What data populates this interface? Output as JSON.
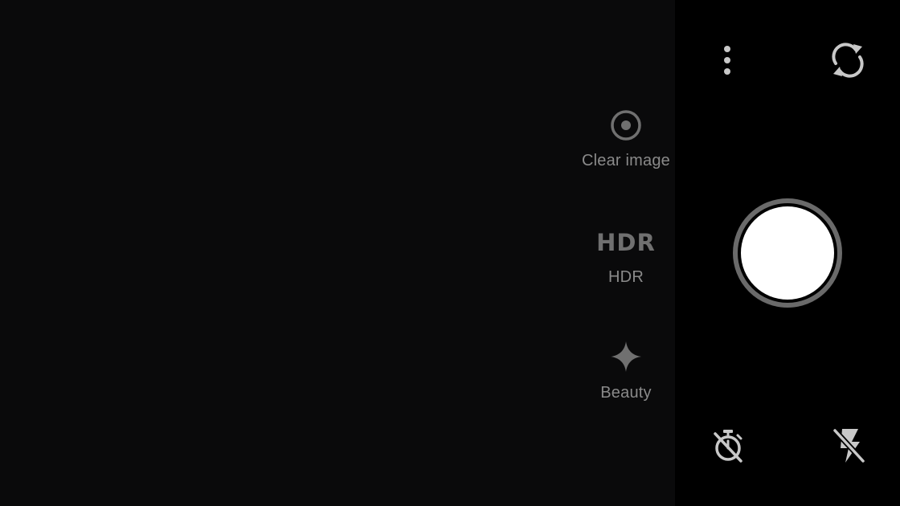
{
  "viewfinder": {
    "background": "#0a0a0b"
  },
  "modes": {
    "clear_image": {
      "label": "Clear image",
      "icon": "target-icon"
    },
    "hdr": {
      "label": "HDR",
      "icon_text": "HDR",
      "icon": "hdr-icon"
    },
    "beauty": {
      "label": "Beauty",
      "icon": "sparkle-icon"
    }
  },
  "controls": {
    "more_icon": "more-vertical-icon",
    "switch_camera_icon": "switch-camera-icon",
    "shutter_icon": "shutter-button",
    "timer_icon": "timer-off-icon",
    "flash_icon": "flash-off-icon"
  },
  "colors": {
    "panel_background": "#000000",
    "mode_label": "#8a8a8a",
    "mode_icon": "#707070",
    "control_icon": "#c8c8c8",
    "shutter_ring": "#6a6a6a",
    "shutter_fill": "#ffffff"
  }
}
